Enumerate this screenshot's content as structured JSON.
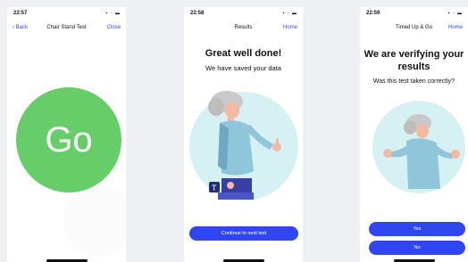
{
  "screen1": {
    "time": "22:57",
    "nav_left": "Back",
    "nav_title": "Chair Stand Test",
    "nav_right": "Close",
    "go_label": "Go"
  },
  "screen2": {
    "time": "22:58",
    "nav_title": "Results",
    "nav_right": "Home",
    "heading": "Great well done!",
    "subheading": "We have saved your data",
    "continue_label": "Continue to next test"
  },
  "screen3": {
    "time": "22:59",
    "nav_title": "Timed Up & Go",
    "nav_right": "Home",
    "heading": "We are verifying your results",
    "subheading": "Was this test taken correctly?",
    "yes_label": "Yes",
    "no_label": "No"
  },
  "colors": {
    "accent": "#2f46f0",
    "go_green": "#67cd68",
    "illustration_bg": "#d6f1f3"
  }
}
